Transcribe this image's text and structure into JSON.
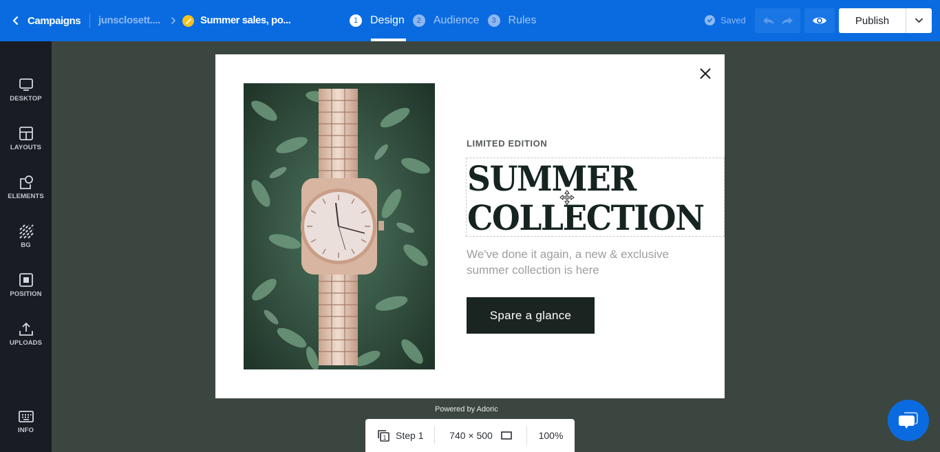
{
  "topbar": {
    "back_label": "Campaigns",
    "site_name": "junsclosett....",
    "campaign_name": "Summer sales, po...",
    "steps": [
      {
        "number": "1",
        "label": "Design",
        "active": true
      },
      {
        "number": "2",
        "label": "Audience",
        "active": false
      },
      {
        "number": "3",
        "label": "Rules",
        "active": false
      }
    ],
    "saved_label": "Saved",
    "publish_label": "Publish",
    "colors": {
      "bar": "#0a6be0",
      "status_dot": "#f7c21c"
    }
  },
  "sidebar": {
    "items": [
      {
        "label": "DESKTOP",
        "icon": "monitor-icon"
      },
      {
        "label": "LAYOUTS",
        "icon": "layout-icon"
      },
      {
        "label": "ELEMENTS",
        "icon": "shapes-icon"
      },
      {
        "label": "BG",
        "icon": "background-stripes-icon"
      },
      {
        "label": "POSITION",
        "icon": "position-icon"
      },
      {
        "label": "UPLOADS",
        "icon": "upload-icon"
      },
      {
        "label": "INFO",
        "icon": "keyboard-icon"
      }
    ]
  },
  "popup": {
    "eyebrow": "LIMITED EDITION",
    "headline_line1": "SUMMER",
    "headline_line2": "COLLECTION",
    "body": "We've done it again, a new & exclusive summer collection is here",
    "cta_label": "Spare a glance",
    "image_alt": "Rose gold wristwatch on green succulent leaves",
    "colors": {
      "cta_bg": "#1a2420",
      "headline": "#152321"
    }
  },
  "footer": {
    "powered_by": "Powered by Adoric",
    "step_label": "Step 1",
    "step_badge": "1",
    "size_label": "740 × 500",
    "zoom_label": "100%"
  }
}
